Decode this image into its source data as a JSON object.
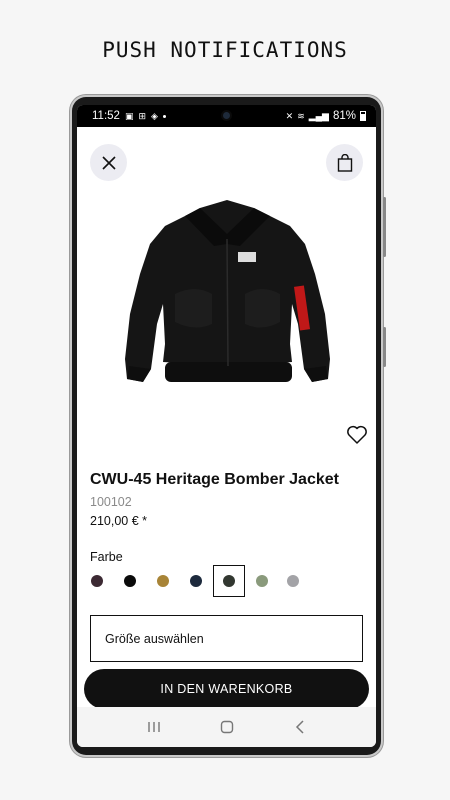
{
  "headline": "PUSH NOTIFICATIONS",
  "status_bar": {
    "time": "11:52",
    "battery": "81%"
  },
  "product": {
    "title": "CWU-45 Heritage Bomber Jacket",
    "sku": "100102",
    "price": "210,00 € *"
  },
  "colors": {
    "label": "Farbe",
    "swatches": [
      {
        "name": "plum",
        "hex": "#3c2a33"
      },
      {
        "name": "black",
        "hex": "#0a0a0a"
      },
      {
        "name": "wheat",
        "hex": "#a88437"
      },
      {
        "name": "navy",
        "hex": "#1d2a3d"
      },
      {
        "name": "dark-olive",
        "hex": "#323730",
        "selected": true
      },
      {
        "name": "sage",
        "hex": "#8a9a7c"
      },
      {
        "name": "grey",
        "hex": "#a3a3a7"
      }
    ]
  },
  "size_select": {
    "label": "Größe auswählen"
  },
  "cta": {
    "label": "IN DEN WARENKORB"
  }
}
